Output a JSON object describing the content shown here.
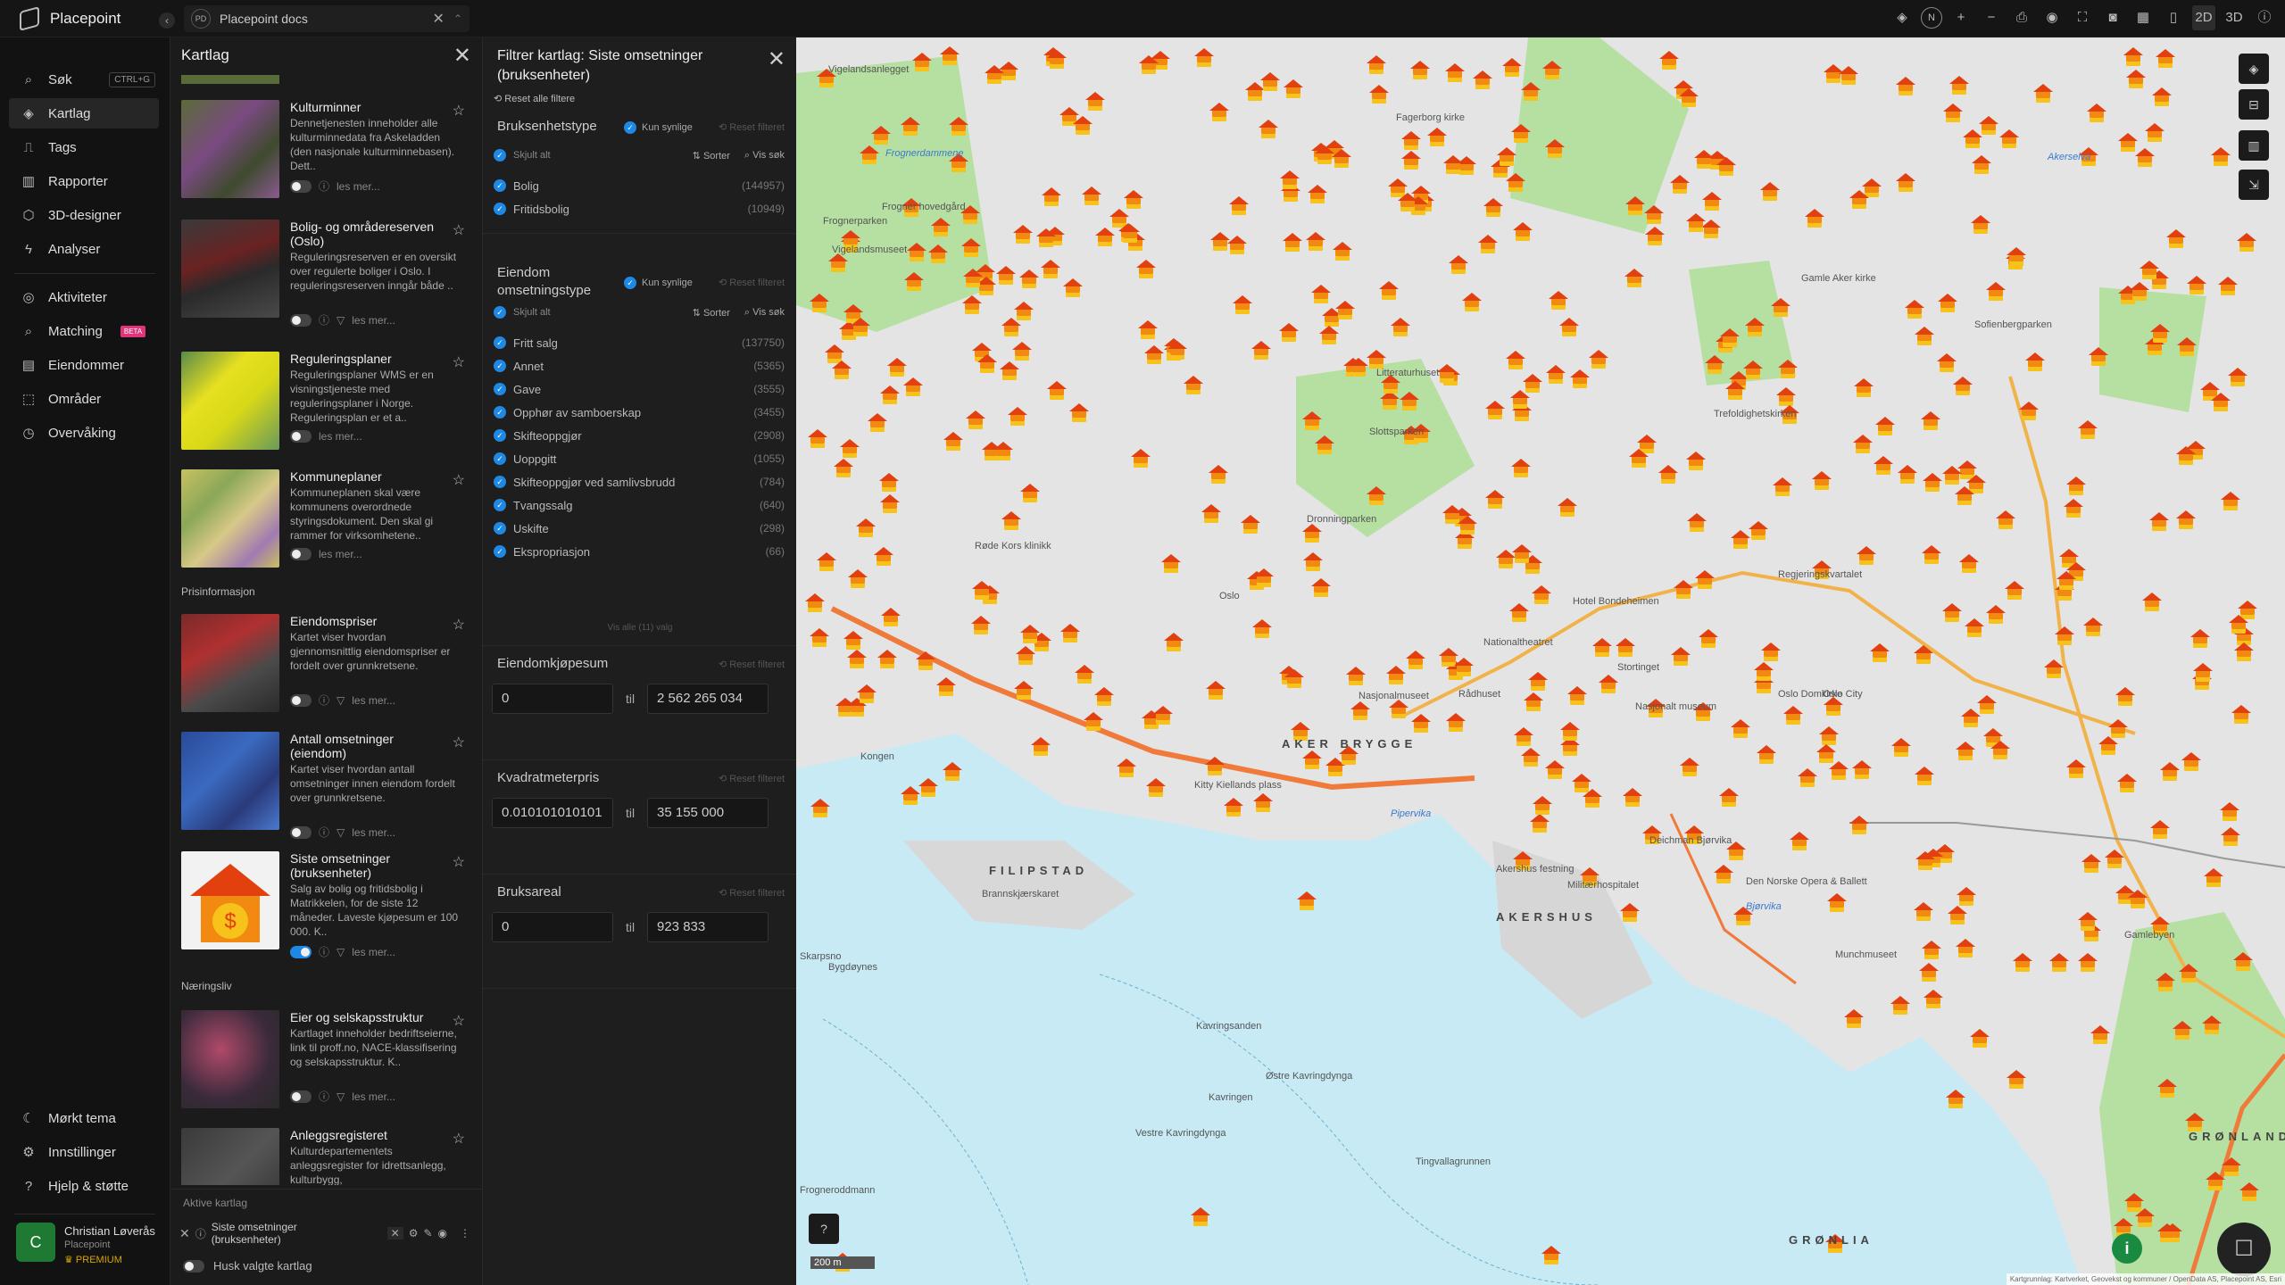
{
  "app": {
    "name": "Placepoint",
    "tab_title": "Placepoint docs",
    "tab_badge": "PD"
  },
  "toolbar": {
    "north": "N",
    "mode_2d": "2D",
    "mode_3d": "3D"
  },
  "nav": {
    "items": [
      {
        "label": "Søk",
        "icon": "search-icon",
        "shortcut": "CTRL+G"
      },
      {
        "label": "Kartlag",
        "icon": "layers-icon"
      },
      {
        "label": "Tags",
        "icon": "bookmark-icon"
      },
      {
        "label": "Rapporter",
        "icon": "chart-icon"
      },
      {
        "label": "3D-designer",
        "icon": "cube-icon"
      },
      {
        "label": "Analyser",
        "icon": "bolt-icon"
      }
    ],
    "items2": [
      {
        "label": "Aktiviteter",
        "icon": "activity-icon"
      },
      {
        "label": "Matching",
        "icon": "match-icon",
        "badge": "BETA"
      },
      {
        "label": "Eiendommer",
        "icon": "document-icon"
      },
      {
        "label": "Områder",
        "icon": "area-icon"
      },
      {
        "label": "Overvåking",
        "icon": "monitor-icon"
      }
    ],
    "bottom": [
      {
        "label": "Mørkt tema",
        "icon": "moon-icon"
      },
      {
        "label": "Innstillinger",
        "icon": "gear-icon"
      },
      {
        "label": "Hjelp & støtte",
        "icon": "help-icon"
      }
    ],
    "user": {
      "initial": "C",
      "name": "Christian Løverås",
      "org": "Placepoint",
      "plan": "PREMIUM"
    }
  },
  "layers": {
    "title": "Kartlag",
    "read_more": "les mer...",
    "section_pris": "Prisinformasjon",
    "section_naering": "Næringsliv",
    "cards": [
      {
        "title": "Kulturminner",
        "desc": "Dennetjenesten inneholder alle kulturminnedata fra Askeladden (den nasjonale kulturminnebasen). Dett..",
        "on": false
      },
      {
        "title": "Bolig- og områdereserven (Oslo)",
        "desc": "Reguleringsreserven er en oversikt over regulerte boliger i Oslo. I reguleringsreserven inngår både ..",
        "on": false
      },
      {
        "title": "Reguleringsplaner",
        "desc": "Reguleringsplaner WMS er en visningstjeneste med reguleringsplaner i Norge. Reguleringsplan er et a..",
        "on": false
      },
      {
        "title": "Kommuneplaner",
        "desc": "Kommuneplanen skal være kommunens overordnede styringsdokument. Den skal gi rammer for virksomhetene..",
        "on": false
      },
      {
        "title": "Eiendomspriser",
        "desc": "Kartet viser hvordan gjennomsnittlig eiendomspriser er fordelt over grunnkretsene.",
        "on": false
      },
      {
        "title": "Antall omsetninger (eiendom)",
        "desc": "Kartet viser hvordan antall omsetninger innen eiendom fordelt over grunnkretsene.",
        "on": false
      },
      {
        "title": "Siste omsetninger (bruksenheter)",
        "desc": "Salg av bolig og fritidsbolig i Matrikkelen, for de siste 12 måneder. Laveste kjøpesum er 100 000. K..",
        "on": true
      },
      {
        "title": "Eier og selskapsstruktur",
        "desc": "Kartlaget inneholder bedriftseierne, link til proff.no, NACE-klassifisering og selskapsstruktur. K..",
        "on": false
      },
      {
        "title": "Anleggsregisteret",
        "desc": "Kulturdepartementets anleggsregister for idrettsanlegg, kulturbygg,",
        "on": false
      }
    ],
    "active_title": "Aktive kartlag",
    "active_item": "Siste omsetninger (bruksenheter)",
    "remember": "Husk valgte kartlag"
  },
  "filter": {
    "title": "Filtrer kartlag: Siste omsetninger (bruksenheter)",
    "reset_all": "Reset alle filtere",
    "visible_only": "Kun synlige",
    "reset_filter": "Reset filteret",
    "hide_all": "Skjult alt",
    "sort": "Sorter",
    "show_search": "Vis søk",
    "to": "til",
    "s1": {
      "title": "Bruksenhetstype",
      "rows": [
        {
          "label": "Bolig",
          "count": "(144957)"
        },
        {
          "label": "Fritidsbolig",
          "count": "(10949)"
        }
      ]
    },
    "s2": {
      "title": "Eiendom omsetningstype",
      "rows": [
        {
          "label": "Fritt salg",
          "count": "(137750)"
        },
        {
          "label": "Annet",
          "count": "(5365)"
        },
        {
          "label": "Gave",
          "count": "(3555)"
        },
        {
          "label": "Opphør av samboerskap",
          "count": "(3455)"
        },
        {
          "label": "Skifteoppgjør",
          "count": "(2908)"
        },
        {
          "label": "Uoppgitt",
          "count": "(1055)"
        },
        {
          "label": "Skifteoppgjør ved samlivsbrudd",
          "count": "(784)"
        },
        {
          "label": "Tvangssalg",
          "count": "(640)"
        },
        {
          "label": "Uskifte",
          "count": "(298)"
        },
        {
          "label": "Ekspropriasjon",
          "count": "(66)"
        }
      ],
      "show_all": "Vis alle (11) valg"
    },
    "s3": {
      "title": "Eiendomkjøpesum",
      "min": "0",
      "max": "2 562 265 034"
    },
    "s4": {
      "title": "Kvadratmeterpris",
      "min": "0.010101010101",
      "max": "35 155 000"
    },
    "s5": {
      "title": "Bruksareal",
      "min": "0",
      "max": "923 833"
    }
  },
  "map": {
    "scale": "200 m",
    "attribution": "Kartgrunnlag: Kartverket, Geovekst og kommuner / OpenData AS, Placepoint AS, Esri",
    "districts": [
      "FILIPSTAD",
      "AKERSHUS",
      "GRØNLIA",
      "AKER BRYGGE",
      "GRØNLAND"
    ],
    "places": [
      "Vigelandsanlegget",
      "Frognerdammene",
      "Frogner hovedgård",
      "Vigelandsmuseet",
      "Frognerparken",
      "Litteraturhuset",
      "Slottsparken",
      "Dronningparken",
      "Røde Kors klinikk",
      "Oslo",
      "Nationaltheatret",
      "Nasjonalmuseet",
      "Rådhuset",
      "Stortinget",
      "Hotel Bondeheimen",
      "Oslo Domkirke",
      "Oslo City",
      "Nasjonalt museum",
      "Kongen",
      "Skarpsno",
      "Frogneroddmann",
      "Kitty Kiellands plass",
      "Akershus festning",
      "Militærhospitalet",
      "Den Norske Opera & Ballett",
      "Munchmuseet",
      "Deichman Bjørvika",
      "Kavringsanden",
      "Kavringen",
      "Østre Kavringdynga",
      "Vestre Kavringdynga",
      "Tingvallagrunnen",
      "Brannskjærskaret",
      "Bygdøynes",
      "Fagerborg kirke",
      "Gamle Aker kirke",
      "Trefoldighetskirken",
      "Regjeringskvartalet",
      "Sofienbergparken",
      "Gamlebyen"
    ],
    "water": [
      "Pipervika",
      "Bjørvika",
      "Akerselva"
    ]
  }
}
